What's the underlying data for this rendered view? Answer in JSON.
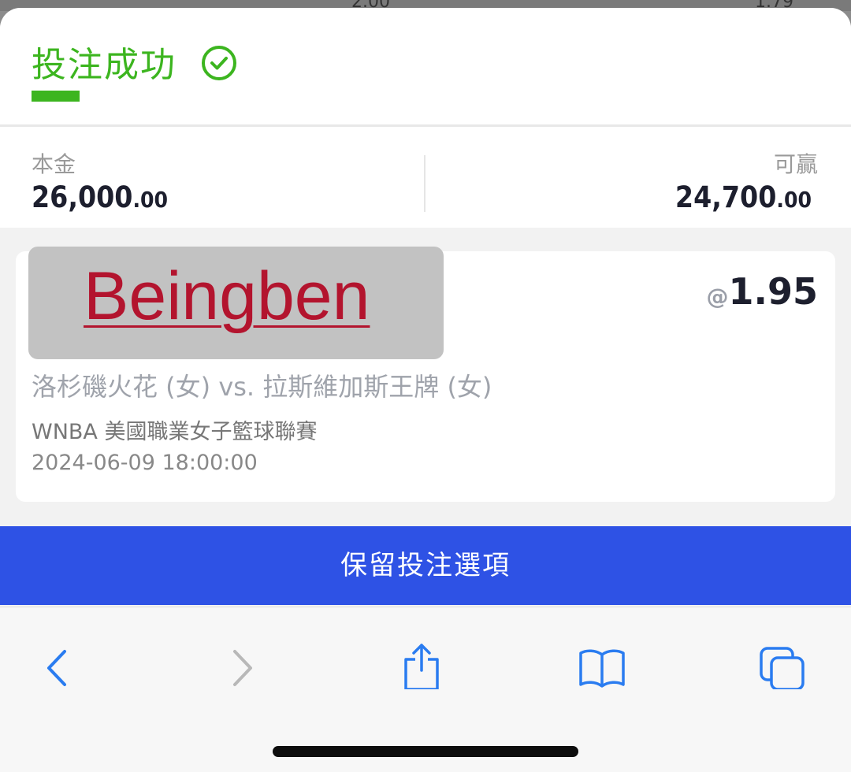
{
  "background_strip": {
    "left_value": "2.00",
    "right_value": "1.79"
  },
  "header": {
    "title": "投注成功",
    "accent_color": "#3cb51f"
  },
  "amounts": {
    "stake": {
      "label": "本金",
      "value": "26,000",
      "cents": ".00"
    },
    "potential_win": {
      "label": "可贏",
      "value": "24,700",
      "cents": ".00"
    }
  },
  "bet_card": {
    "logo_text": "Beingben",
    "odds_prefix": "@",
    "odds_value": "1.95",
    "match": "洛杉磯火花 (女) vs. 拉斯維加斯王牌 (女)",
    "league": "WNBA 美國職業女子籃球聯賽",
    "datetime": "2024-06-09 18:00:00"
  },
  "keep_button": {
    "label": "保留投注選項",
    "color": "#2e52e5"
  },
  "toolbar": {
    "icons": [
      "chevron-left-icon",
      "chevron-right-icon",
      "share-icon",
      "book-icon",
      "tabs-icon"
    ],
    "accent_color": "#2a7cf0"
  }
}
